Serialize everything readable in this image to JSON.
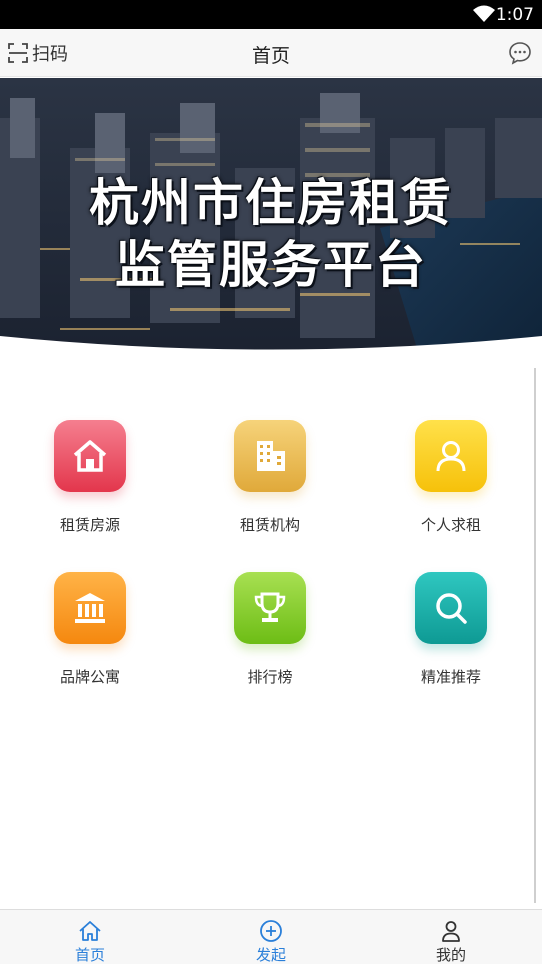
{
  "status_bar": {
    "time": "1:07"
  },
  "header": {
    "scan_label": "扫码",
    "title": "首页",
    "scan_icon": "scan-icon",
    "message_icon": "message-icon"
  },
  "banner": {
    "line1": "杭州市住房租赁",
    "line2": "监管服务平台"
  },
  "grid": {
    "items": [
      {
        "label": "租赁房源",
        "icon": "house-icon",
        "color": "#e3364c"
      },
      {
        "label": "租赁机构",
        "icon": "building-icon",
        "color": "#e0a93a"
      },
      {
        "label": "个人求租",
        "icon": "person-icon",
        "color": "#f6c10a"
      },
      {
        "label": "品牌公寓",
        "icon": "bank-icon",
        "color": "#f5880f"
      },
      {
        "label": "排行榜",
        "icon": "trophy-icon",
        "color": "#6dbd15"
      },
      {
        "label": "精准推荐",
        "icon": "search-icon",
        "color": "#0e9a94"
      }
    ]
  },
  "tabbar": {
    "tabs": [
      {
        "label": "首页",
        "icon": "home-icon",
        "active": true
      },
      {
        "label": "发起",
        "icon": "plus-circle-icon",
        "active": false
      },
      {
        "label": "我的",
        "icon": "user-icon",
        "active": false
      }
    ],
    "active_color": "#2a7fd9"
  }
}
